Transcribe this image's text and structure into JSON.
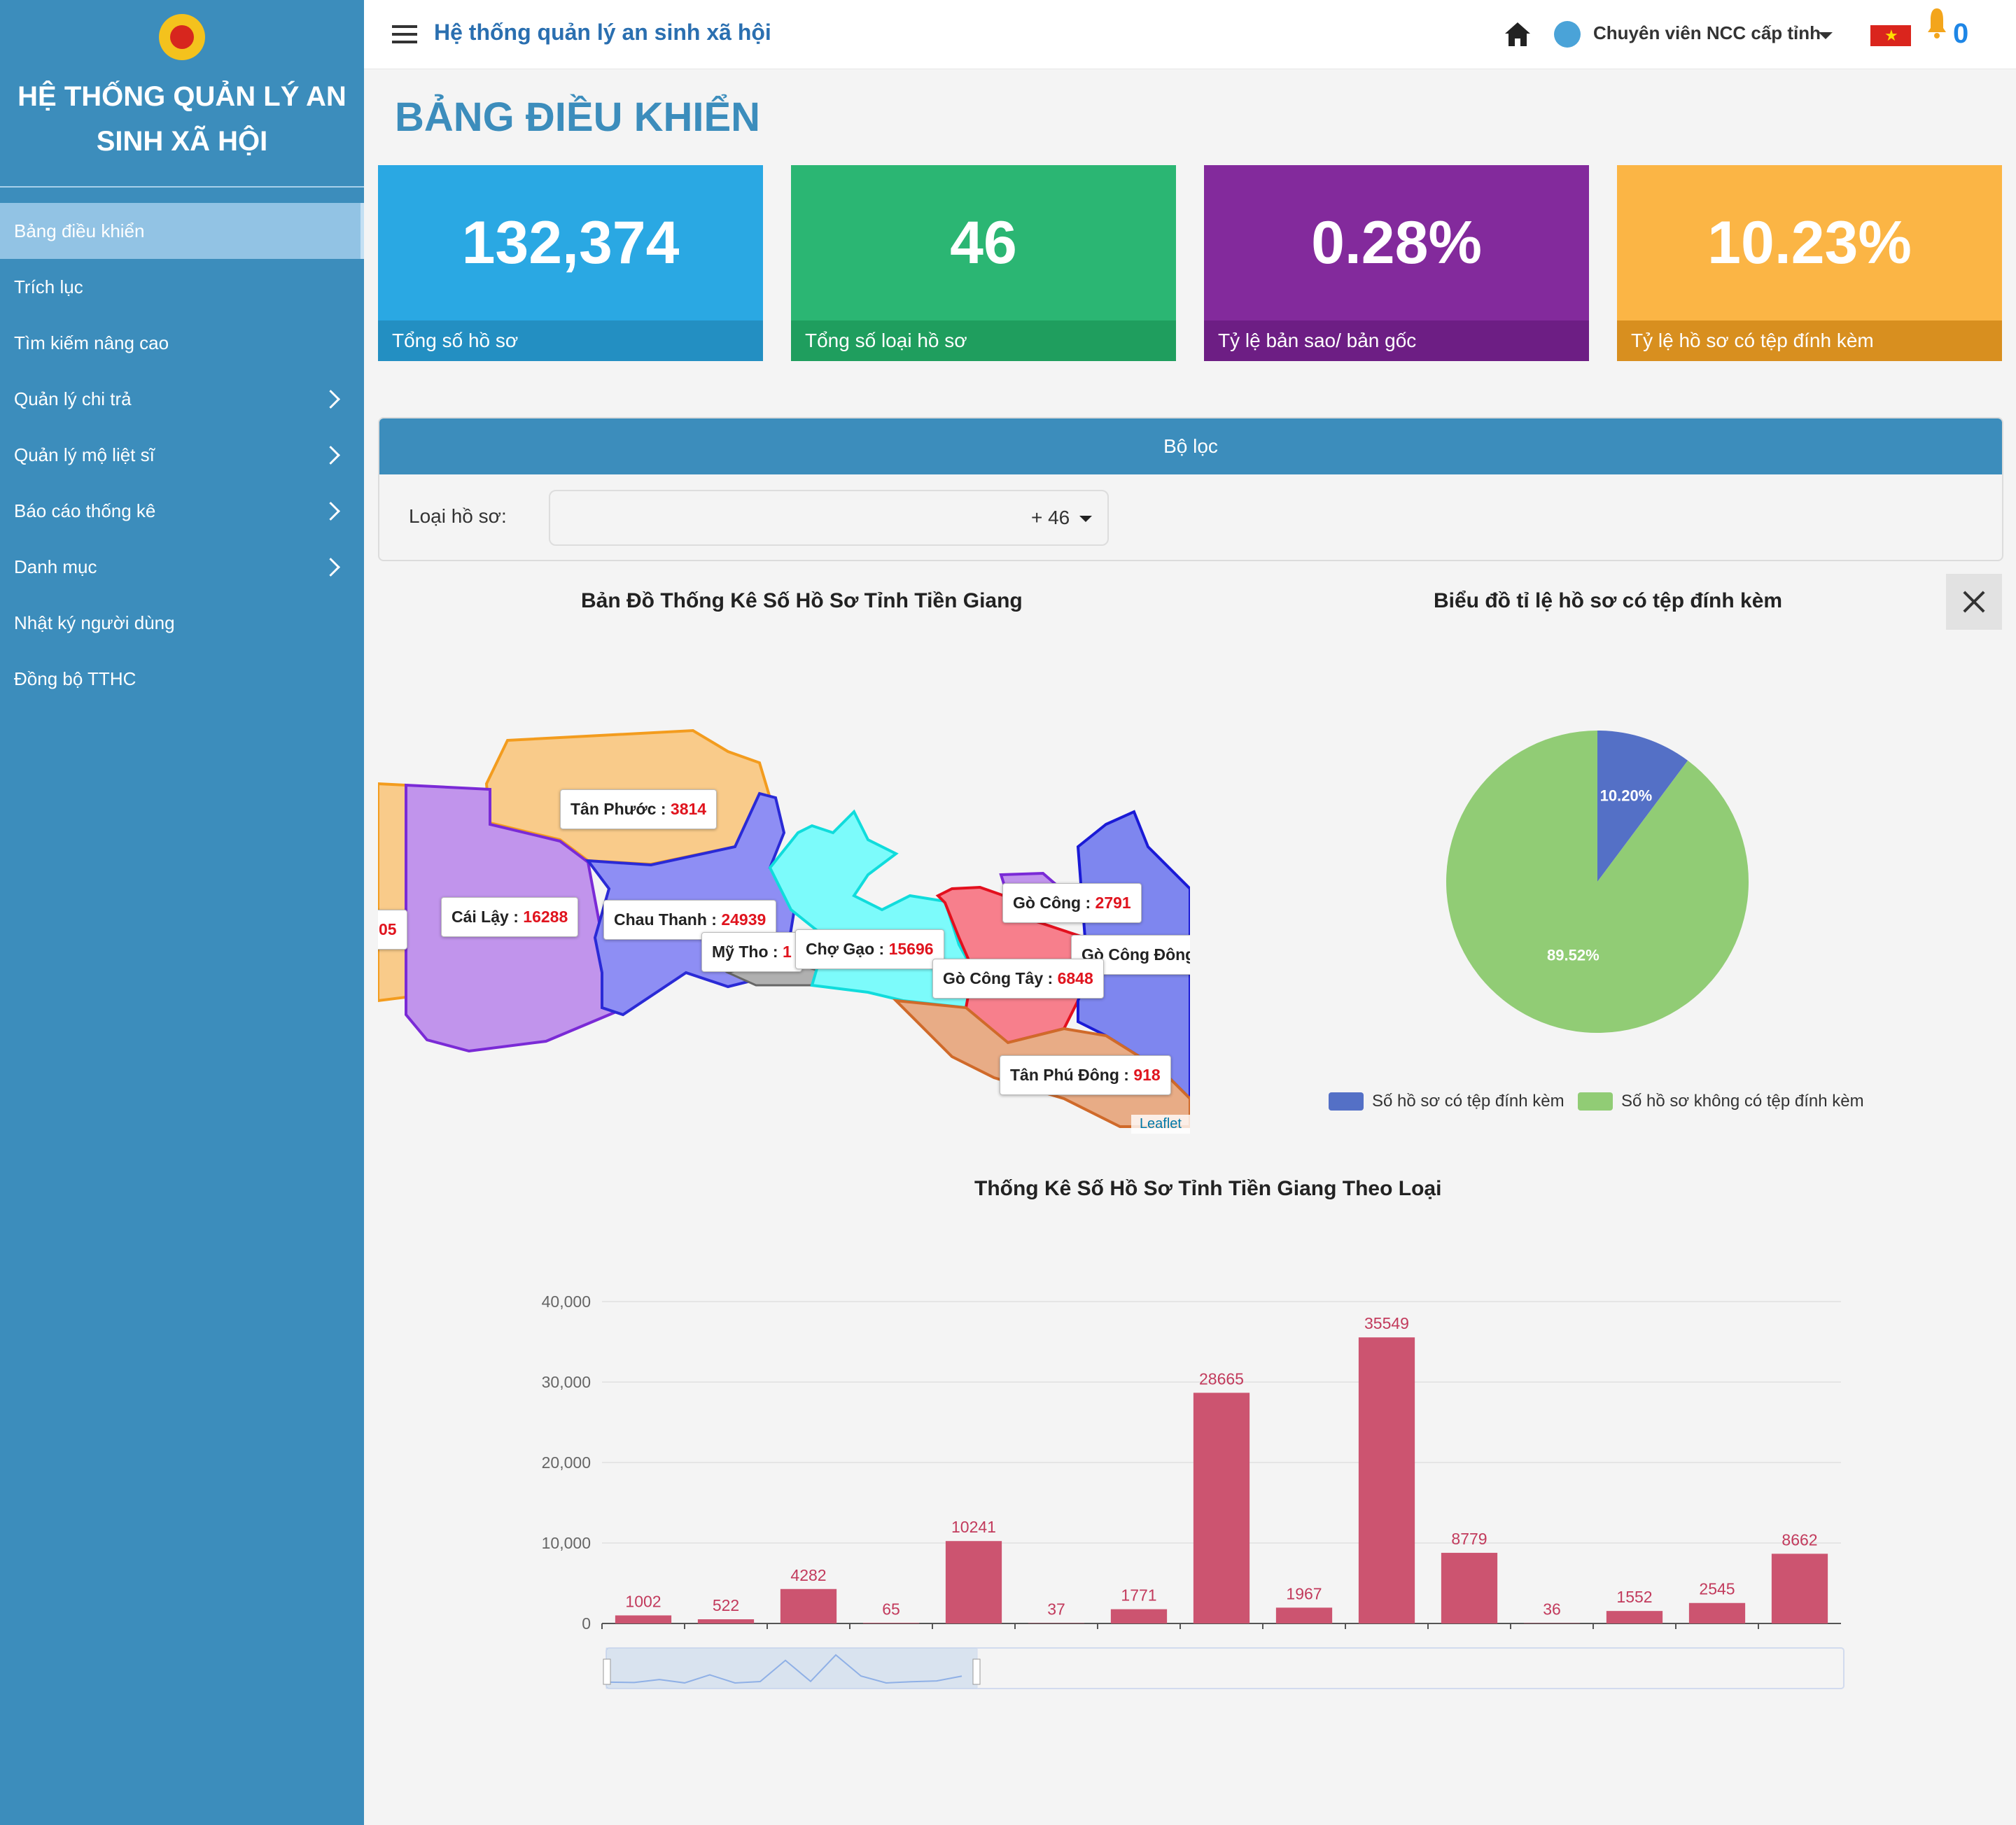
{
  "sidebar": {
    "brand_line1": "HỆ THỐNG QUẢN LÝ AN",
    "brand_line2": "SINH XÃ HỘI",
    "items": [
      {
        "label": "Bảng điều khiển",
        "active": true,
        "has_children": false
      },
      {
        "label": "Trích lục",
        "has_children": false
      },
      {
        "label": "Tìm kiếm nâng cao",
        "has_children": false
      },
      {
        "label": "Quản lý chi trả",
        "has_children": true
      },
      {
        "label": "Quản lý mộ liệt sĩ",
        "has_children": true
      },
      {
        "label": "Báo cáo thống kê",
        "has_children": true
      },
      {
        "label": "Danh mục",
        "has_children": true
      },
      {
        "label": "Nhật ký người dùng",
        "has_children": false
      },
      {
        "label": "Đồng bộ TTHC",
        "has_children": false
      }
    ]
  },
  "header": {
    "app_name": "Hệ thống quản lý an sinh xã hội",
    "user_name": "Chuyên viên NCC cấp tỉnh",
    "notification_count": "0",
    "icons": [
      "menu-icon",
      "home-icon",
      "user-avatar",
      "vietnam-flag-icon",
      "bell-icon"
    ]
  },
  "page_title": "BẢNG ĐIỀU KHIỂN",
  "kpis": [
    {
      "value": "132,374",
      "label": "Tổng số hồ sơ",
      "color": "#2aa8e3",
      "color_dark": "#238fc2"
    },
    {
      "value": "46",
      "label": "Tổng số loại hồ sơ",
      "color": "#2bb673",
      "color_dark": "#1f9e5e"
    },
    {
      "value": "0.28%",
      "label": "Tỷ lệ bản sao/ bản gốc",
      "color": "#832a9c",
      "color_dark": "#6d1e84"
    },
    {
      "value": "10.23%",
      "label": "Tỷ lệ hồ sơ có tệp đính kèm",
      "color": "#fbb545",
      "color_dark": "#d88f1f"
    }
  ],
  "filter": {
    "title": "Bộ lọc",
    "label": "Loại hồ sơ:",
    "selected": "+ 46"
  },
  "map": {
    "title": "Bản Đồ Thống Kê Số Hồ Sơ Tỉnh Tiền Giang",
    "attribution": "Leaflet",
    "labels": [
      {
        "name": "Tân Phước",
        "value": "3814"
      },
      {
        "name": "Cái Lậy",
        "value": "16288"
      },
      {
        "name": "",
        "value": "05"
      },
      {
        "name": "Chau Thanh",
        "value": "24939"
      },
      {
        "name": "Mỹ Tho",
        "value": "1"
      },
      {
        "name": "Chợ Gạo",
        "value": "15696"
      },
      {
        "name": "Gò Công",
        "value": "2791"
      },
      {
        "name": "Gò Công Đông",
        "value": ""
      },
      {
        "name": "Gò Công Tây",
        "value": "6848"
      },
      {
        "name": "Tân Phú Đông",
        "value": "918"
      }
    ]
  },
  "pie": {
    "title": "Biểu đồ tỉ lệ hồ sơ có tệp đính kèm",
    "slices": [
      {
        "name": "Số hồ sơ có tệp đính kèm",
        "percent": 10.2,
        "label": "10.20%",
        "color": "#5470c6"
      },
      {
        "name": "Số hồ sơ không có tệp đính kèm",
        "percent": 89.8,
        "label": "89.52%",
        "color": "#91cc75"
      }
    ]
  },
  "chart_data": {
    "type": "bar",
    "title": "Thống Kê Số Hồ Sơ Tỉnh Tiền Giang Theo Loại",
    "categories": [
      "",
      "",
      "",
      "",
      "",
      "",
      "",
      "",
      "",
      "",
      "",
      "",
      "",
      "",
      "",
      ""
    ],
    "values": [
      1002,
      522,
      4282,
      65,
      10241,
      37,
      1771,
      28665,
      1967,
      35549,
      8779,
      36,
      1552,
      2545,
      8662
    ],
    "ylim": [
      0,
      40000
    ],
    "yticks": [
      0,
      10000,
      20000,
      30000,
      40000
    ],
    "ytick_labels": [
      "0",
      "10,000",
      "20,000",
      "30,000",
      "40,000"
    ],
    "bar_color": "#cc5470",
    "grid": true,
    "data_zoom": true
  }
}
